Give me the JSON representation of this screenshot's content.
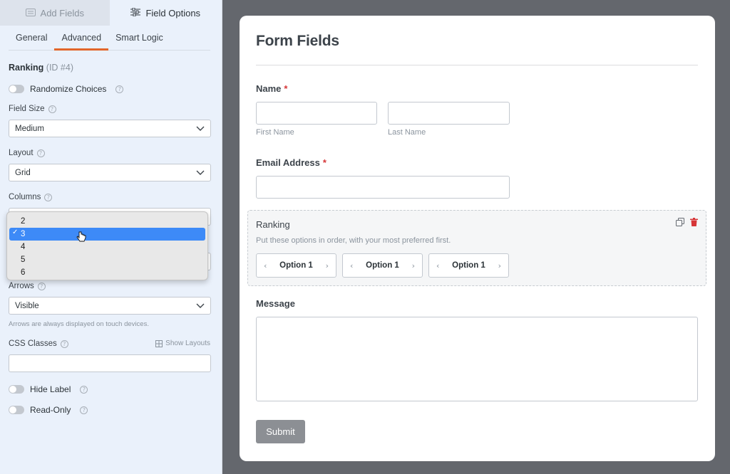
{
  "sidebar": {
    "top_tabs": [
      {
        "label": "Add Fields",
        "icon": "list-icon"
      },
      {
        "label": "Field Options",
        "icon": "sliders-icon"
      }
    ],
    "sub_tabs": [
      "General",
      "Advanced",
      "Smart Logic"
    ],
    "active_sub_tab": "Advanced",
    "field": {
      "name": "Ranking",
      "id_text": "(ID #4)"
    },
    "randomize_label": "Randomize Choices",
    "field_size": {
      "label": "Field Size",
      "value": "Medium"
    },
    "layout": {
      "label": "Layout",
      "value": "Grid"
    },
    "columns": {
      "label": "Columns",
      "options": [
        "2",
        "3",
        "4",
        "5",
        "6"
      ],
      "selected": "3"
    },
    "arrows": {
      "label": "Arrows",
      "value": "Visible",
      "note": "Arrows are always displayed on touch devices."
    },
    "css_classes": {
      "label": "CSS Classes",
      "show_layouts": "Show Layouts",
      "value": ""
    },
    "hide_label": "Hide Label",
    "read_only": "Read-Only",
    "toggle_color_off": "#c3c8cf",
    "accent": "#e2662b"
  },
  "form": {
    "title": "Form Fields",
    "name": {
      "label": "Name",
      "required_mark": "*",
      "first": "First Name",
      "last": "Last Name"
    },
    "email": {
      "label": "Email Address",
      "required_mark": "*"
    },
    "ranking": {
      "label": "Ranking",
      "description": "Put these options in order, with your most preferred first.",
      "options": [
        "Option 1",
        "Option 1",
        "Option 1"
      ]
    },
    "message": {
      "label": "Message"
    },
    "submit_label": "Submit"
  }
}
